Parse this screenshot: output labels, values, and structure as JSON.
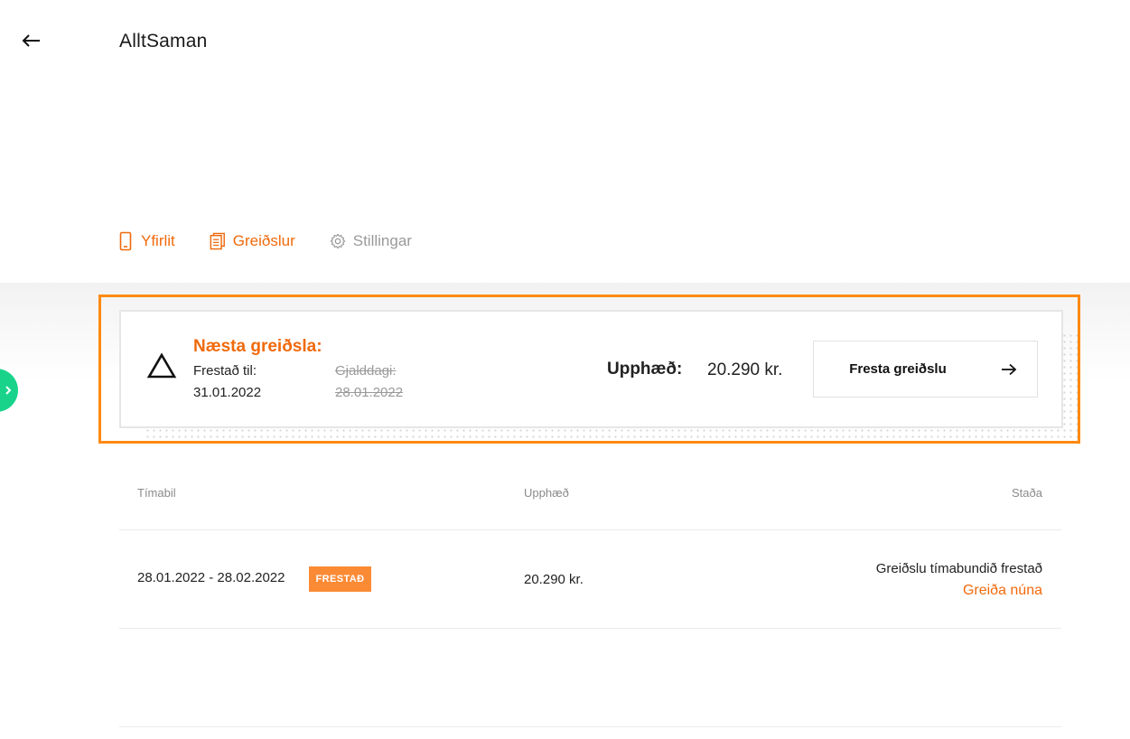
{
  "header": {
    "back_icon": "arrow-left-icon",
    "title": "AlltSaman"
  },
  "tabs": [
    {
      "label": "Yfirlit",
      "icon": "phone-icon",
      "active": true
    },
    {
      "label": "Greiðslur",
      "icon": "invoice-icon",
      "active": true
    },
    {
      "label": "Stillingar",
      "icon": "gear-icon",
      "active": false
    }
  ],
  "payment_card": {
    "title": "Næsta greiðsla:",
    "deferred_label": "Frestað til:",
    "deferred_date": "31.01.2022",
    "due_label": "Gjalddagi:",
    "due_date": "28.01.2022",
    "amount_label": "Upphæð:",
    "amount_value": "20.290 kr.",
    "postpone_button": "Fresta greiðslu",
    "warning_icon": "warning-triangle-icon",
    "arrow_icon": "arrow-right-icon"
  },
  "table": {
    "columns": [
      "Tímabil",
      "Upphæð",
      "Staða"
    ],
    "rows": [
      {
        "period": "28.01.2022 - 28.02.2022",
        "badge": "FRESTAÐ",
        "amount": "20.290 kr.",
        "status": "Greiðslu tímabundið frestað",
        "action": "Greiða núna"
      }
    ]
  },
  "colors": {
    "accent": "#f06a0c",
    "highlight_border": "#ff8a12",
    "badge": "#fb8a35",
    "side_tab": "#19d38b"
  }
}
